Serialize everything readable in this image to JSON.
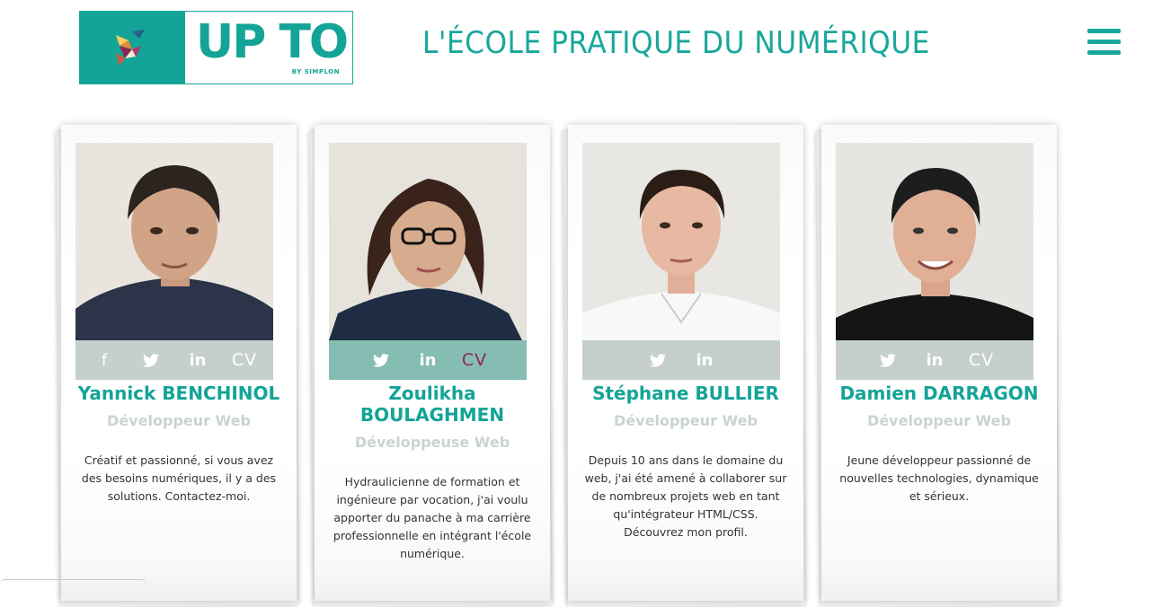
{
  "header": {
    "logo_text": "UP TO",
    "logo_sub": "BY SIMPLON",
    "tagline": "L'ÉCOLE PRATIQUE DU NUMÉRIQUE",
    "menu_icon": "hamburger-menu-icon"
  },
  "colors": {
    "accent": "#13a497",
    "social_gray": "#c5cfcd",
    "social_teal": "#86bdb2",
    "cv_highlight": "#8b2a5a"
  },
  "cards": [
    {
      "name": "Yannick BENCHINOL",
      "role": "Développeur Web",
      "bio": "Créatif et passionné, si vous avez des besoins numériques, il y a des solutions. Contactez-moi.",
      "social": [
        "facebook-icon",
        "twitter-icon",
        "linkedin-icon",
        "cv"
      ],
      "cv_label": "CV"
    },
    {
      "name": "Zoulikha BOULAGHMEN",
      "role": "Développeuse Web",
      "bio": "Hydraulicienne de formation et ingénieure par vocation, j'ai voulu apporter du panache à ma carrière professionnelle en intégrant l'école numérique.",
      "social": [
        "twitter-icon",
        "linkedin-icon",
        "cv"
      ],
      "cv_label": "CV"
    },
    {
      "name": "Stéphane BULLIER",
      "role": "Développeur Web",
      "bio": "Depuis 10 ans dans le domaine du web, j'ai été amené à collaborer sur de nombreux projets web en tant qu'intégrateur HTML/CSS. Découvrez mon profil.",
      "social": [
        "twitter-icon",
        "linkedin-icon"
      ]
    },
    {
      "name": "Damien DARRAGON",
      "role": "Développeur Web",
      "bio": "Jeune développeur passionné de nouvelles technologies, dynamique et sérieux.",
      "social": [
        "twitter-icon",
        "linkedin-icon",
        "cv"
      ],
      "cv_label": "CV"
    }
  ]
}
